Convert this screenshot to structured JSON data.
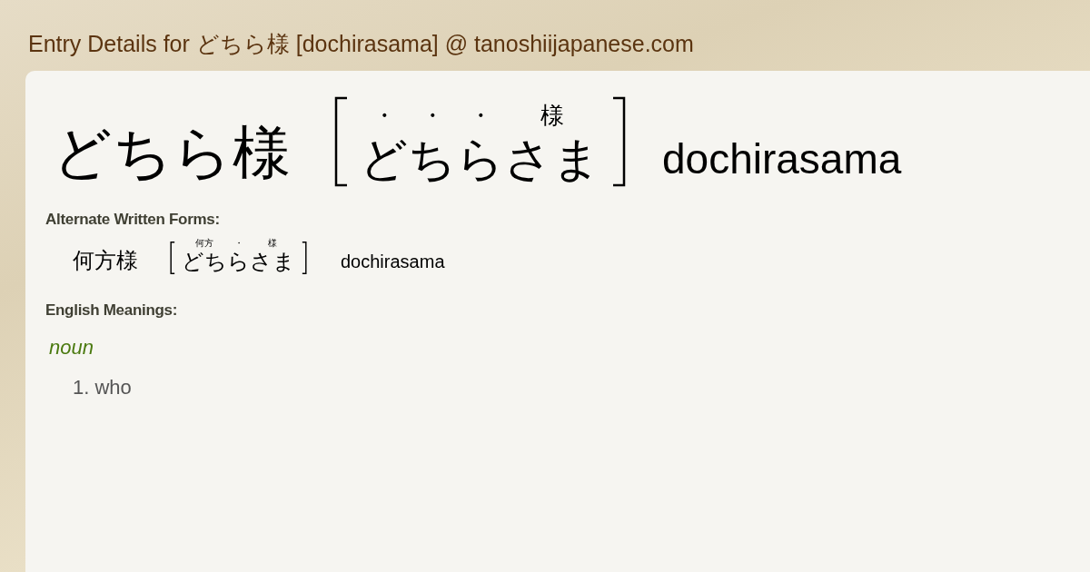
{
  "page_title": "Entry Details for どちら様 [dochirasama] @ tanoshiijapanese.com",
  "entry": {
    "word": "どちら様",
    "reading": [
      {
        "kana": "ど",
        "ruby": "・"
      },
      {
        "kana": "ち",
        "ruby": "・"
      },
      {
        "kana": "ら",
        "ruby": "・"
      },
      {
        "kana": "さま",
        "ruby": "様"
      }
    ],
    "romaji": "dochirasama"
  },
  "alternate_forms": {
    "heading": "Alternate Written Forms:",
    "forms": [
      {
        "word": "何方様",
        "reading": [
          {
            "kana": "どち",
            "ruby": "何方"
          },
          {
            "kana": "ら",
            "ruby": "・"
          },
          {
            "kana": "さま",
            "ruby": "様"
          }
        ],
        "romaji": "dochirasama"
      }
    ]
  },
  "meanings": {
    "heading": "English Meanings:",
    "groups": [
      {
        "part_of_speech": "noun",
        "senses": [
          "1. who"
        ]
      }
    ]
  }
}
